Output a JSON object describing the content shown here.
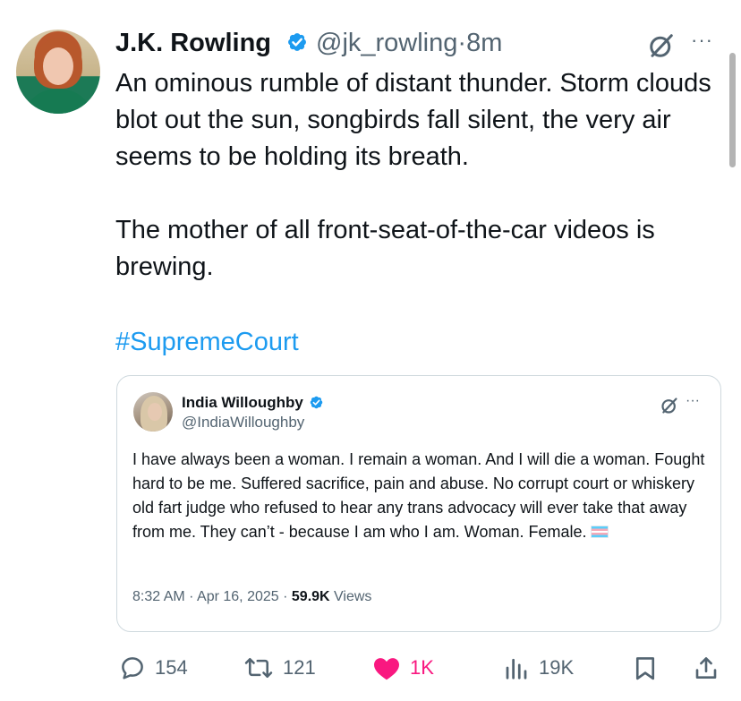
{
  "author": {
    "name": "J.K. Rowling",
    "handle": "@jk_rowling",
    "separator": "·",
    "time": "8m"
  },
  "tweet": {
    "paragraph_1": "An ominous rumble of distant thunder. Storm clouds blot out the sun, songbirds fall silent, the very air seems to be holding its breath.",
    "paragraph_2": "The mother of all front-seat-of-the-car videos is brewing.",
    "hashtag": "#SupremeCourt"
  },
  "quote": {
    "name": "India Willoughby",
    "handle": "@IndiaWilloughby",
    "text": "I have always been a woman. I remain a woman. And I will die a woman. Fought hard to be me. Suffered sacrifice, pain and abuse. No corrupt court or whiskery old fart judge who refused to hear any trans advocacy will ever take that away from me. They can’t - because I am who I am. Woman. Female.",
    "timestamp": "8:32 AM · Apr 16, 2025 · ",
    "views_count": "59.9K",
    "views_label": " Views"
  },
  "actions": {
    "replies": "154",
    "reposts": "121",
    "likes": "1K",
    "views": "19K"
  },
  "colors": {
    "link": "#1d9bf0",
    "like": "#f91880",
    "muted": "#536471",
    "verified": "#1d9bf0"
  },
  "icons": {
    "verified": "verified-badge-icon",
    "grok": "grok-icon",
    "more": "more-icon",
    "reply": "reply-icon",
    "repost": "repost-icon",
    "like": "heart-icon",
    "views": "views-icon",
    "bookmark": "bookmark-icon",
    "share": "share-icon",
    "flag": "trans-flag-emoji"
  }
}
